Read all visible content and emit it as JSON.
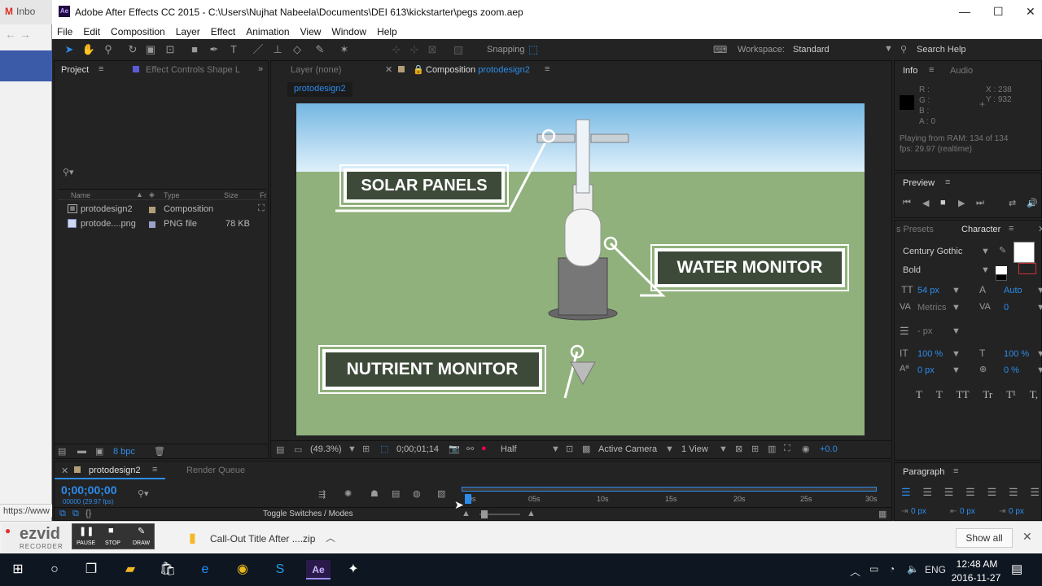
{
  "browser": {
    "tab_label": "Inbo",
    "gmail_letter": "M",
    "url_status": "https://www"
  },
  "window": {
    "title": "Adobe After Effects CC 2015 - C:\\Users\\Nujhat Nabeela\\Documents\\DEI 613\\kickstarter\\pegs zoom.aep",
    "app_icon": "Ae"
  },
  "menu": [
    "File",
    "Edit",
    "Composition",
    "Layer",
    "Effect",
    "Animation",
    "View",
    "Window",
    "Help"
  ],
  "toolbar": {
    "snapping": "Snapping",
    "workspace_label": "Workspace:",
    "workspace_value": "Standard",
    "search_placeholder": "Search Help"
  },
  "project": {
    "tab": "Project",
    "effect_tab": "Effect Controls Shape L",
    "columns": [
      "Name",
      "Type",
      "Size",
      "Fr"
    ],
    "items": [
      {
        "name": "protodesign2",
        "type": "Composition",
        "size": "",
        "color": "#b39e7a"
      },
      {
        "name": "protode....png",
        "type": "PNG file",
        "size": "78 KB",
        "color": "#9aa0c9"
      }
    ],
    "bpc": "8 bpc"
  },
  "comp": {
    "layer_tab": "Layer (none)",
    "comp_tab_prefix": "Composition",
    "comp_name": "protodesign2",
    "breadcrumb": "protodesign2",
    "callouts": {
      "solar": "SOLAR PANELS",
      "water": "WATER MONITOR",
      "nutrient": "NUTRIENT MONITOR"
    },
    "footer": {
      "zoom": "(49.3%)",
      "timecode": "0;00;01;14",
      "resolution": "Half",
      "camera": "Active Camera",
      "views": "1 View",
      "exposure": "+0.0"
    }
  },
  "info": {
    "tab": "Info",
    "audio_tab": "Audio",
    "r": "R :",
    "g": "G :",
    "b": "B :",
    "a": "A : 0",
    "x": "X : 238",
    "y": "Y : 932",
    "playing": "Playing from RAM: 134 of 134",
    "fps": "fps: 29.97 (realtime)"
  },
  "preview": {
    "tab": "Preview"
  },
  "character": {
    "presets_tab": "s Presets",
    "tab": "Character",
    "font": "Century Gothic",
    "style": "Bold",
    "size": "54 px",
    "leading": "Auto",
    "kerning": "Metrics",
    "tracking": "0",
    "stroke": "- px",
    "vscale": "100 %",
    "hscale": "100 %",
    "baseline": "0 px",
    "tsume": "0 %",
    "text_styles": [
      "T",
      "T",
      "TT",
      "Tr",
      "T¹",
      "T,"
    ]
  },
  "paragraph": {
    "tab": "Paragraph",
    "indent_left": "0 px",
    "indent_right": "0 px",
    "indent_first": "0 px"
  },
  "timeline": {
    "comp_tab": "protodesign2",
    "render_tab": "Render Queue",
    "timecode": "0;00;00;00",
    "frames": "00000 (29.97 fps)",
    "toggle": "Toggle Switches / Modes",
    "ruler": [
      "0s",
      "05s",
      "10s",
      "15s",
      "20s",
      "25s",
      "30s"
    ]
  },
  "ezvid": {
    "name": "ezvid",
    "sub": "RECORDER",
    "pause": "PAUSE",
    "stop": "STOP",
    "draw": "DRAW"
  },
  "downloads": {
    "file": "Call-Out Title After ....zip",
    "show_all": "Show all"
  },
  "taskbar": {
    "time": "12:48 AM",
    "date": "2016-11-27",
    "lang": "ENG"
  }
}
